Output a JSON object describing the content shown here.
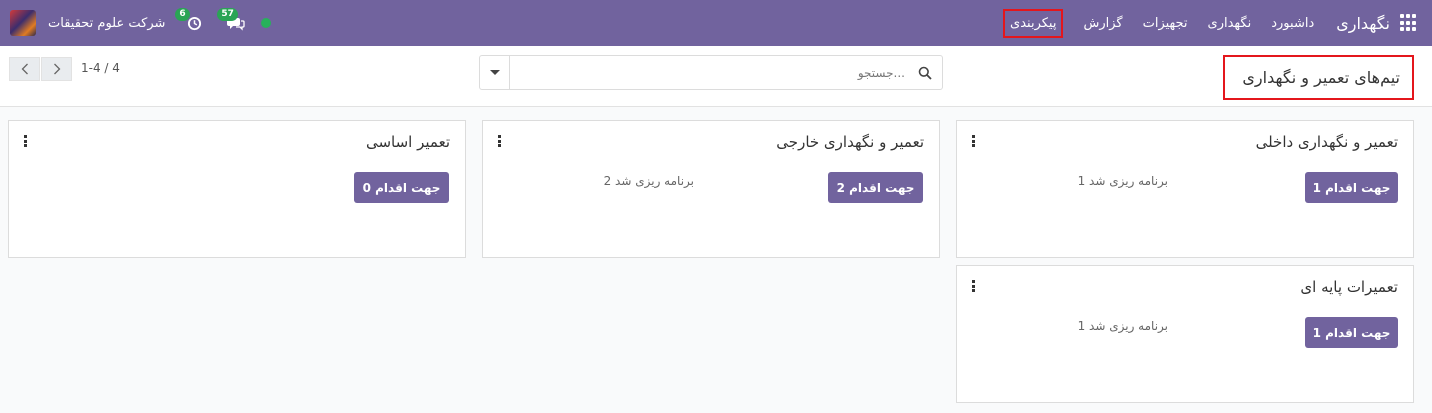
{
  "navbar": {
    "brand": "نگهداری",
    "menu": [
      "داشبورد",
      "نگهداری",
      "تجهیزات",
      "گزارش",
      "پیکربندی"
    ],
    "company": "شرکت علوم تحقیقات",
    "activity_badge": "6",
    "messages_badge": "57",
    "colors": {
      "background": "#71639e",
      "status": "#27b15b",
      "badge": "#2aa455",
      "highlight": "#e4161c"
    }
  },
  "control": {
    "title": "تیم‌های تعمیر و نگهداری",
    "search_placeholder": "جستجو...",
    "pager": "1-4 / 4"
  },
  "cards": [
    {
      "title": "تعمیر و نگهداری داخلی",
      "button": "1 جهت اقدام",
      "planned": "1 برنامه ریزی شد"
    },
    {
      "title": "تعمیر و نگهداری خارجی",
      "button": "2 جهت اقدام",
      "planned": "2 برنامه ریزی شد"
    },
    {
      "title": "تعمیر اساسی",
      "button": "0 جهت اقدام",
      "planned": ""
    },
    {
      "title": "تعمیرات پایه ای",
      "button": "1 جهت اقدام",
      "planned": "1 برنامه ریزی شد"
    }
  ],
  "icons": [
    "apps-grid-icon",
    "search-icon",
    "caret-down-icon",
    "chevron-left-icon",
    "chevron-right-icon",
    "chat-icon",
    "clock-icon",
    "kebab-menu-icon"
  ]
}
